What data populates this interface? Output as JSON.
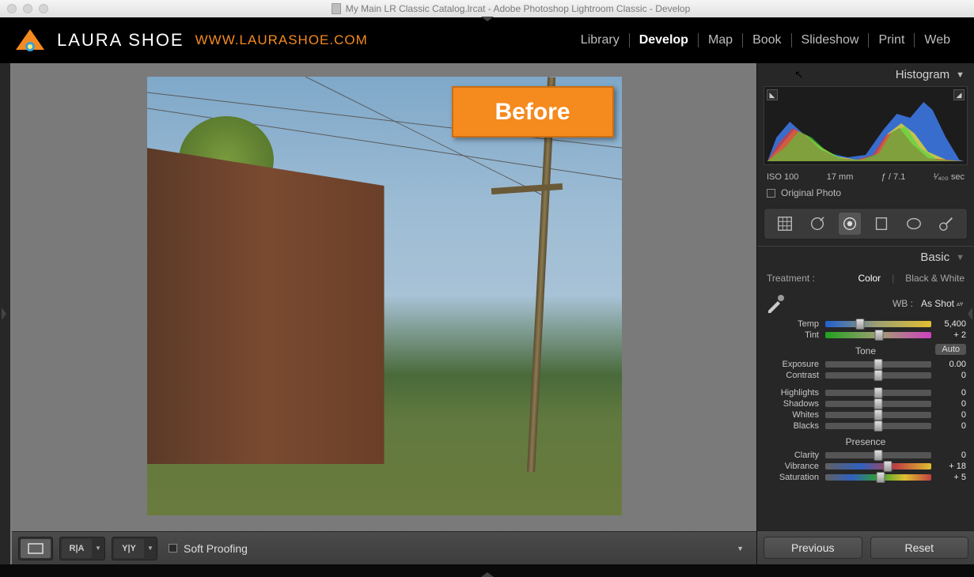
{
  "title": "My Main LR Classic Catalog.lrcat - Adobe Photoshop Lightroom Classic - Develop",
  "identity": {
    "brand": "LAURA SHOE",
    "url": "WWW.LAURASHOE.COM"
  },
  "modules": [
    "Library",
    "Develop",
    "Map",
    "Book",
    "Slideshow",
    "Print",
    "Web"
  ],
  "active_module": "Develop",
  "before_label": "Before",
  "histogram": {
    "title": "Histogram",
    "exif": {
      "iso": "ISO 100",
      "focal": "17 mm",
      "aperture": "ƒ / 7.1",
      "shutter": "¹⁄₄₀₀ sec"
    },
    "original_label": "Original Photo"
  },
  "basic": {
    "title": "Basic",
    "treatment_label": "Treatment :",
    "treatment_opts": {
      "color": "Color",
      "bw": "Black & White"
    },
    "wb": {
      "label": "WB :",
      "value": "As Shot"
    },
    "sliders": {
      "temp": {
        "label": "Temp",
        "value": "5,400",
        "pos": 33
      },
      "tint": {
        "label": "Tint",
        "value": "+ 2",
        "pos": 51
      },
      "exposure": {
        "label": "Exposure",
        "value": "0.00",
        "pos": 50
      },
      "contrast": {
        "label": "Contrast",
        "value": "0",
        "pos": 50
      },
      "highlights": {
        "label": "Highlights",
        "value": "0",
        "pos": 50
      },
      "shadows": {
        "label": "Shadows",
        "value": "0",
        "pos": 50
      },
      "whites": {
        "label": "Whites",
        "value": "0",
        "pos": 50
      },
      "blacks": {
        "label": "Blacks",
        "value": "0",
        "pos": 50
      },
      "clarity": {
        "label": "Clarity",
        "value": "0",
        "pos": 50
      },
      "vibrance": {
        "label": "Vibrance",
        "value": "+ 18",
        "pos": 59
      },
      "saturation": {
        "label": "Saturation",
        "value": "+ 5",
        "pos": 52
      }
    },
    "tone_label": "Tone",
    "auto_label": "Auto",
    "presence_label": "Presence"
  },
  "toolbar": {
    "soft_proofing": "Soft Proofing",
    "previous": "Previous",
    "reset": "Reset"
  }
}
